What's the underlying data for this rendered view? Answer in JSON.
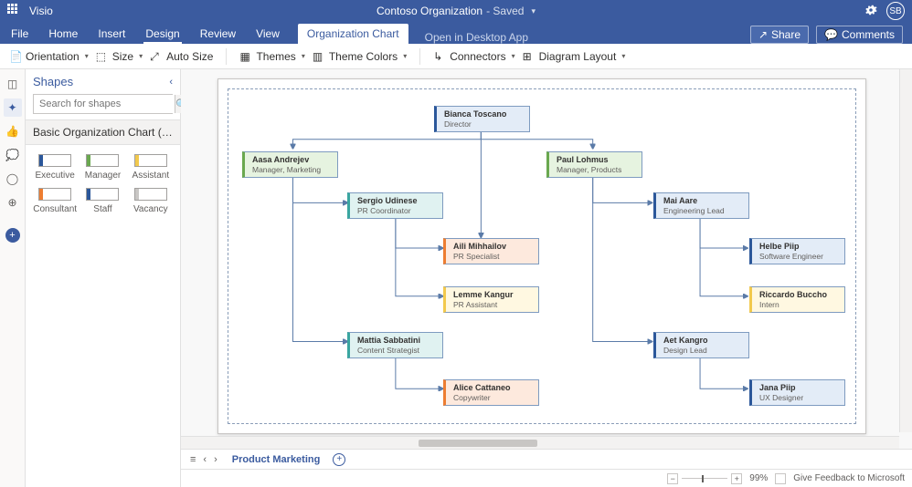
{
  "titlebar": {
    "app_name": "Visio",
    "doc_name": "Contoso Organization",
    "doc_status": "- Saved",
    "user_initials": "SB"
  },
  "ribbon_tabs": {
    "items": [
      "File",
      "Home",
      "Insert",
      "Design",
      "Review",
      "View",
      "Organization Chart"
    ],
    "open_desktop": "Open in Desktop App",
    "share": "Share",
    "comments": "Comments"
  },
  "toolbar": {
    "orientation": "Orientation",
    "size": "Size",
    "auto_size": "Auto Size",
    "themes": "Themes",
    "theme_colors": "Theme Colors",
    "connectors": "Connectors",
    "diagram_layout": "Diagram Layout"
  },
  "shapes_panel": {
    "title": "Shapes",
    "search_placeholder": "Search for shapes",
    "stencil": "Basic Organization Chart (Lega...",
    "shapes": [
      {
        "label": "Executive",
        "color": "#2b579a"
      },
      {
        "label": "Manager",
        "color": "#6aa84f"
      },
      {
        "label": "Assistant",
        "color": "#f2c94c"
      },
      {
        "label": "Consultant",
        "color": "#ed7d31"
      },
      {
        "label": "Staff",
        "color": "#2b579a"
      },
      {
        "label": "Vacancy",
        "color": "#c8c6c4"
      }
    ]
  },
  "org": {
    "root": {
      "name": "Bianca Toscano",
      "role": "Director",
      "style": "blue"
    },
    "mgr_left": {
      "name": "Aasa Andrejev",
      "role": "Manager, Marketing",
      "style": "green"
    },
    "mgr_right": {
      "name": "Paul Lohmus",
      "role": "Manager, Products",
      "style": "green"
    },
    "l1": {
      "name": "Sergio Udinese",
      "role": "PR Coordinator",
      "style": "teal"
    },
    "l1a": {
      "name": "Aili Mihhailov",
      "role": "PR Specialist",
      "style": "orange"
    },
    "l1b": {
      "name": "Lemme Kangur",
      "role": "PR Assistant",
      "style": "yellow"
    },
    "l2": {
      "name": "Mattia Sabbatini",
      "role": "Content Strategist",
      "style": "teal"
    },
    "l2a": {
      "name": "Alice Cattaneo",
      "role": "Copywriter",
      "style": "orange"
    },
    "r1": {
      "name": "Mai Aare",
      "role": "Engineering Lead",
      "style": "blue"
    },
    "r1a": {
      "name": "Helbe Piip",
      "role": "Software Engineer",
      "style": "blue"
    },
    "r1b": {
      "name": "Riccardo Buccho",
      "role": "Intern",
      "style": "yellow"
    },
    "r2": {
      "name": "Aet Kangro",
      "role": "Design Lead",
      "style": "blue"
    },
    "r2a": {
      "name": "Jana Piip",
      "role": "UX Designer",
      "style": "blue"
    }
  },
  "sheets": {
    "active": "Product Marketing"
  },
  "status": {
    "zoom": "99%",
    "feedback": "Give Feedback to Microsoft"
  }
}
